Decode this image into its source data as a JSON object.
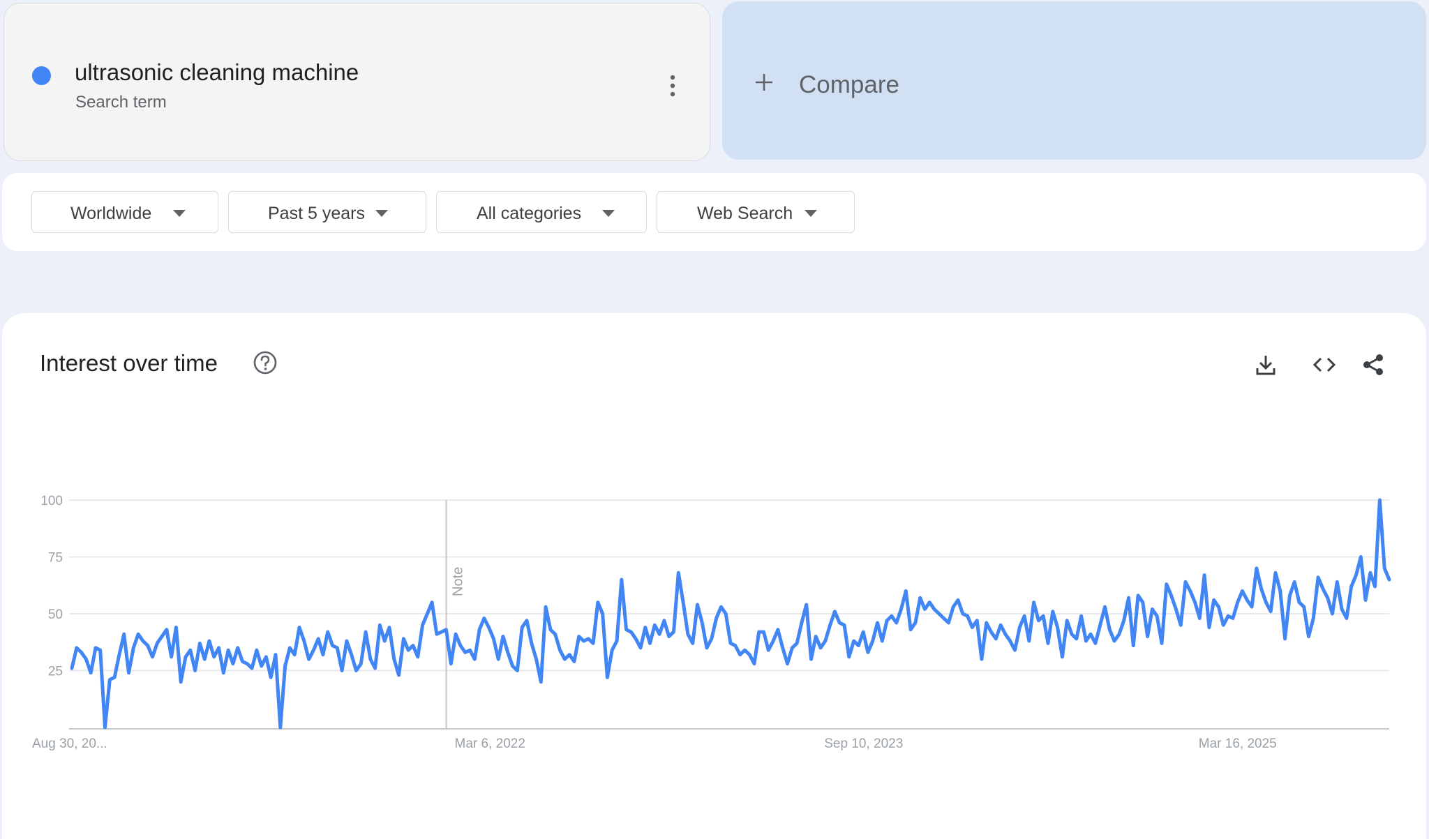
{
  "term": {
    "title": "ultrasonic cleaning machine",
    "subtitle": "Search term",
    "dot_color": "#4285f4",
    "menu_icon": "more-vert-icon"
  },
  "compare": {
    "label": "Compare",
    "icon": "plus-icon"
  },
  "filters": [
    {
      "label": "Worldwide"
    },
    {
      "label": "Past 5 years"
    },
    {
      "label": "All categories"
    },
    {
      "label": "Web Search"
    }
  ],
  "chart_panel": {
    "title": "Interest over time",
    "help_icon": "help-circle-icon",
    "actions": [
      "download-icon",
      "embed-code-icon",
      "share-icon"
    ]
  },
  "chart_data": {
    "type": "line",
    "title": "",
    "xlabel": "",
    "ylabel": "",
    "ylim": [
      0,
      100
    ],
    "yticks": [
      25,
      50,
      75,
      100
    ],
    "grid": true,
    "x_tick_labels": [
      "Aug 30, 20...",
      "Mar 6, 2022",
      "Sep 10, 2023",
      "Mar 16, 2025"
    ],
    "x_tick_index": [
      0,
      79,
      157,
      236
    ],
    "annotation": {
      "label": "Note",
      "index": 79
    },
    "line_color": "#4285f4",
    "series": [
      {
        "values": [
          26,
          35,
          33,
          30,
          24,
          35,
          34,
          0,
          21,
          22,
          32,
          41,
          24,
          35,
          41,
          38,
          36,
          31,
          37,
          40,
          43,
          31,
          44,
          20,
          31,
          34,
          25,
          37,
          30,
          38,
          31,
          35,
          24,
          34,
          28,
          35,
          29,
          28,
          26,
          34,
          27,
          31,
          22,
          32,
          0,
          27,
          35,
          32,
          44,
          38,
          30,
          34,
          39,
          32,
          42,
          36,
          35,
          25,
          38,
          32,
          25,
          28,
          42,
          30,
          26,
          45,
          38,
          44,
          30,
          23,
          39,
          34,
          36,
          31,
          45,
          50,
          55,
          41,
          42,
          43,
          28,
          41,
          36,
          33,
          34,
          30,
          43,
          48,
          44,
          39,
          30,
          40,
          33,
          27,
          25,
          44,
          47,
          37,
          30,
          20,
          53,
          43,
          41,
          34,
          30,
          32,
          29,
          40,
          38,
          39,
          37,
          55,
          50,
          22,
          34,
          38,
          65,
          43,
          42,
          39,
          35,
          44,
          37,
          45,
          41,
          47,
          40,
          42,
          68,
          55,
          41,
          37,
          54,
          46,
          35,
          39,
          48,
          53,
          50,
          37,
          36,
          32,
          34,
          32,
          28,
          42,
          42,
          34,
          38,
          43,
          35,
          28,
          35,
          37,
          46,
          54,
          30,
          40,
          35,
          38,
          45,
          51,
          46,
          45,
          31,
          38,
          36,
          42,
          33,
          38,
          46,
          38,
          47,
          49,
          46,
          52,
          60,
          43,
          46,
          57,
          52,
          55,
          52,
          50,
          48,
          46,
          53,
          56,
          50,
          49,
          44,
          47,
          30,
          46,
          42,
          39,
          45,
          41,
          38,
          34,
          44,
          49,
          38,
          55,
          47,
          49,
          37,
          51,
          44,
          31,
          47,
          41,
          39,
          49,
          38,
          41,
          37,
          45,
          53,
          43,
          38,
          41,
          47,
          57,
          36,
          58,
          55,
          40,
          52,
          49,
          37,
          63,
          58,
          52,
          45,
          64,
          60,
          55,
          48,
          67,
          44,
          56,
          53,
          45,
          49,
          48,
          55,
          60,
          56,
          53,
          70,
          61,
          55,
          51,
          68,
          60,
          39,
          58,
          64,
          55,
          53,
          40,
          48,
          66,
          61,
          57,
          50,
          64,
          52,
          48,
          62,
          67,
          75,
          56,
          68,
          62,
          100,
          70,
          65
        ]
      }
    ]
  }
}
